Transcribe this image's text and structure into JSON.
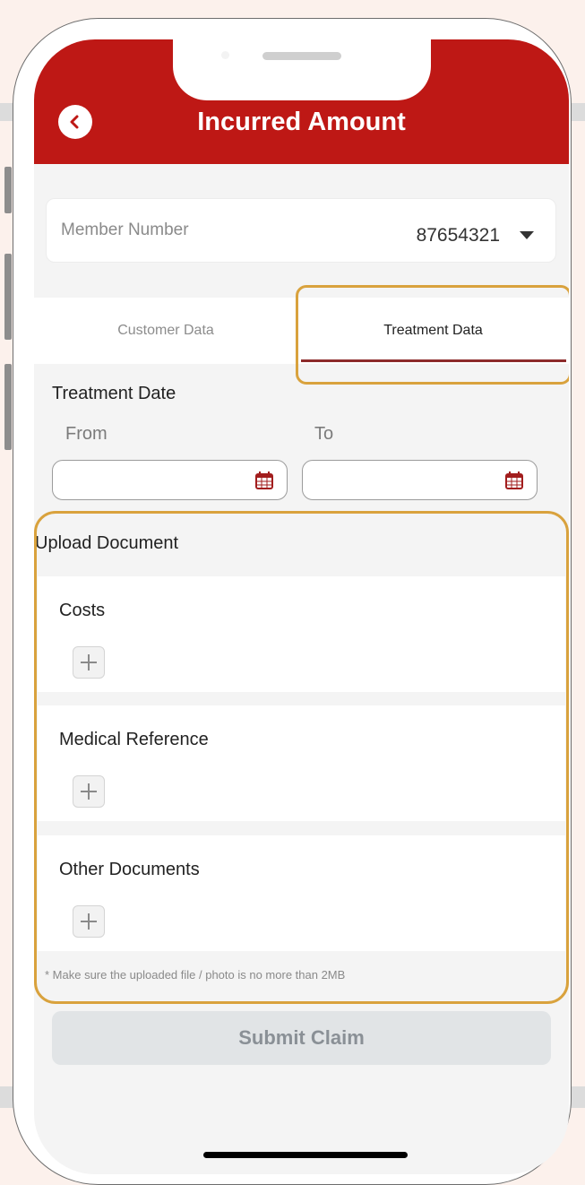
{
  "header": {
    "title": "Incurred Amount"
  },
  "member": {
    "label": "Member Number",
    "value": "87654321"
  },
  "tabs": [
    {
      "label": "Customer Data",
      "active": false
    },
    {
      "label": "Treatment Data",
      "active": true
    }
  ],
  "treatment": {
    "label": "Treatment Date",
    "from_label": "From",
    "to_label": "To"
  },
  "upload": {
    "title": "Upload Document",
    "sections": [
      {
        "label": "Costs"
      },
      {
        "label": "Medical Reference"
      },
      {
        "label": "Other Documents"
      }
    ],
    "note": "* Make sure the uploaded file / photo is no more than 2MB"
  },
  "submit_label": "Submit Claim",
  "colors": {
    "brand_red": "#be1815",
    "highlight": "#d9a23d",
    "tab_underline": "#8d2b2b"
  },
  "icons": [
    "back-arrow-icon",
    "chevron-down-icon",
    "calendar-icon",
    "plus-icon"
  ]
}
